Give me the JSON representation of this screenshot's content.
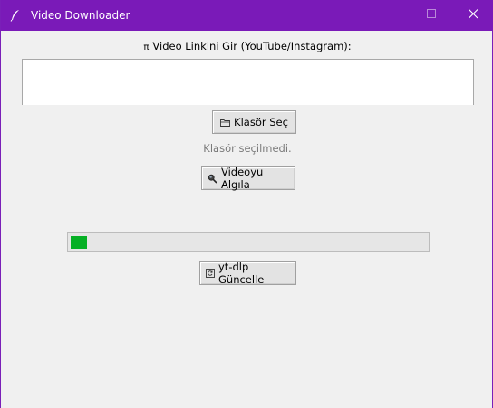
{
  "window": {
    "title": "Video Downloader",
    "title_bar_color": "#7a1ab8",
    "app_icon": "feather-icon",
    "controls": [
      "minimize-icon",
      "maximize-icon",
      "close-icon"
    ]
  },
  "prompt": {
    "icon": "pi-symbol-icon",
    "label": "Video Linkini Gir (YouTube/Instagram):"
  },
  "url_input": {
    "value": "",
    "placeholder": ""
  },
  "folder_button": {
    "icon": "folder-icon",
    "label": "Klasör Seç"
  },
  "folder_status": {
    "text": "Klasör seçilmedi.",
    "color": "#7a7a7a"
  },
  "detect_button": {
    "icon": "magnifier-icon",
    "label": "Videoyu Algıla"
  },
  "progress": {
    "value_fraction": 0.045,
    "fill_color": "#06b025"
  },
  "update_button": {
    "icon": "refresh-icon",
    "label": "yt-dlp Güncelle"
  }
}
